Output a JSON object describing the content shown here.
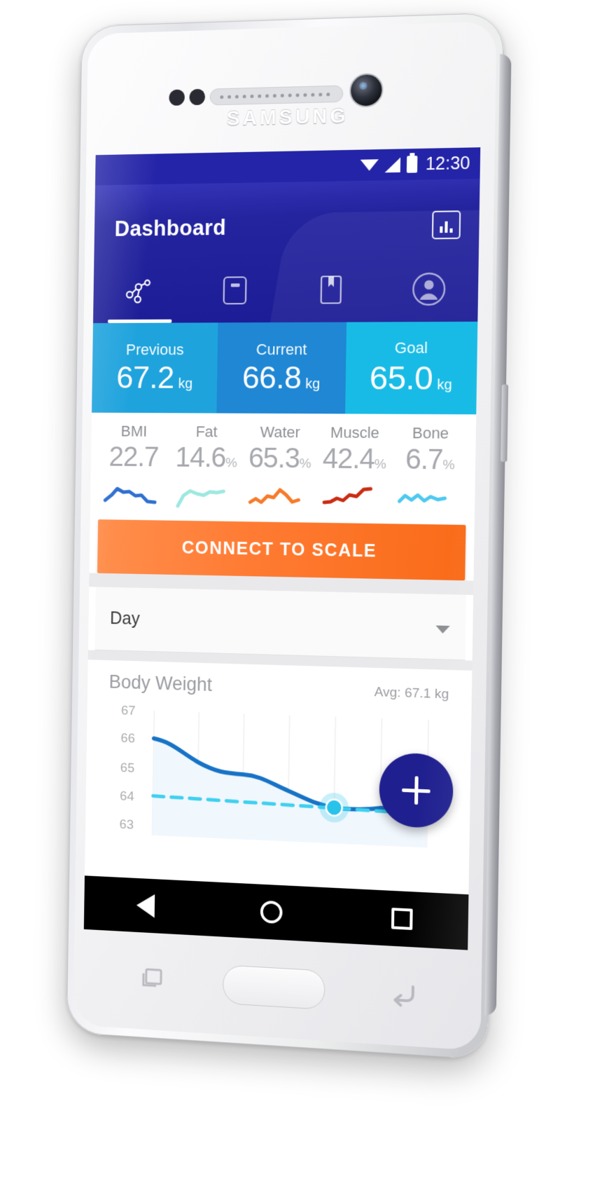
{
  "device": {
    "brand": "SAMSUNG"
  },
  "statusbar": {
    "time": "12:30",
    "icons": [
      "wifi-icon",
      "signal-icon",
      "battery-icon"
    ]
  },
  "appbar": {
    "title": "Dashboard",
    "chart_button_icon": "bar-chart-icon"
  },
  "tabs": [
    {
      "name": "tab-trends",
      "icon": "scatter-graph-icon",
      "active": true
    },
    {
      "name": "tab-scale",
      "icon": "scale-device-icon",
      "active": false
    },
    {
      "name": "tab-notes",
      "icon": "bookmark-icon",
      "active": false
    },
    {
      "name": "tab-profile",
      "icon": "person-avatar-icon",
      "active": false
    }
  ],
  "weight_cards": [
    {
      "label": "Previous",
      "value": "67.2",
      "unit": "kg",
      "color": "#1fa3dd"
    },
    {
      "label": "Current",
      "value": "66.8",
      "unit": "kg",
      "color": "#1f87d4"
    },
    {
      "label": "Goal",
      "value": "65.0",
      "unit": "kg",
      "color": "#18bbe5"
    }
  ],
  "metrics": [
    {
      "label": "BMI",
      "value": "22.7",
      "unit": "",
      "spark_color": "#2f6fd0"
    },
    {
      "label": "Fat",
      "value": "14.6",
      "unit": "%",
      "spark_color": "#9de8e0"
    },
    {
      "label": "Water",
      "value": "65.3",
      "unit": "%",
      "spark_color": "#f57b2a"
    },
    {
      "label": "Muscle",
      "value": "42.4",
      "unit": "%",
      "spark_color": "#cc2b12"
    },
    {
      "label": "Bone",
      "value": "6.7",
      "unit": "%",
      "spark_color": "#4ec9ef"
    }
  ],
  "connect_button": {
    "label": "CONNECT TO SCALE",
    "color": "#f96b18"
  },
  "period_select": {
    "value": "Day",
    "icon": "chevron-down-icon"
  },
  "fab": {
    "icon": "plus-icon",
    "color": "#1f1f8f"
  },
  "navbar": {
    "back": "back-triangle-icon",
    "home": "home-circle-icon",
    "recents": "recents-square-icon"
  },
  "chart_data": {
    "type": "line",
    "title": "Body Weight",
    "annotation": "Avg: 67.1 kg",
    "xlabel": "",
    "ylabel": "",
    "ylim": [
      63,
      67.4
    ],
    "yticks": [
      67,
      66,
      65,
      64,
      63
    ],
    "grid": true,
    "legend_position": "none",
    "x": [
      0,
      1,
      2,
      3,
      4,
      5,
      6,
      7,
      8
    ],
    "series": [
      {
        "name": "Body Weight",
        "color": "#1773c6",
        "fill": "#eaf4fc",
        "values": [
          66.05,
          65.55,
          65.15,
          65.1,
          64.85,
          64.5,
          64.25,
          64.2,
          64.3
        ]
      },
      {
        "name": "Goal",
        "color": "#3fd0ef",
        "style": "dashed",
        "values": [
          65.0,
          64.9,
          64.8,
          64.7,
          64.6,
          64.5,
          64.45,
          64.4,
          64.35
        ]
      }
    ],
    "highlight_point": {
      "x": 5,
      "y": 64.5,
      "color": "#29c3ea"
    }
  }
}
